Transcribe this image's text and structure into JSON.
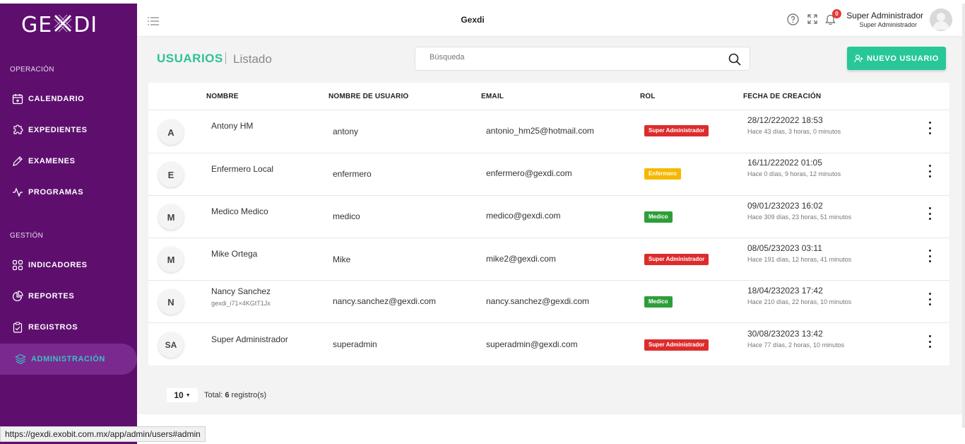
{
  "app": {
    "logo": "GEXDI",
    "title": "Gexdi"
  },
  "sidebar": {
    "sections": [
      {
        "label": "OPERACIÓN"
      },
      {
        "label": "GESTIÓN"
      }
    ],
    "items": [
      {
        "label": "CALENDARIO",
        "icon": "calendar-plus-icon"
      },
      {
        "label": "EXPEDIENTES",
        "icon": "puzzle-icon"
      },
      {
        "label": "EXAMENES",
        "icon": "pen-icon"
      },
      {
        "label": "PROGRAMAS",
        "icon": "activity-icon"
      },
      {
        "label": "INDICADORES",
        "icon": "grid-icon"
      },
      {
        "label": "REPORTES",
        "icon": "pie-chart-icon"
      },
      {
        "label": "REGISTROS",
        "icon": "clipboard-icon"
      },
      {
        "label": "ADMINISTRACIÓN",
        "icon": "layers-icon",
        "active": true
      }
    ]
  },
  "topbar": {
    "notifications_count": "0",
    "user_name": "Super Administrador",
    "user_role": "Super Administrador"
  },
  "page": {
    "title": "USUARIOS",
    "subtitle": "Listado",
    "search_placeholder": "Búsqueda",
    "new_button_label": "NUEVO USUARIO"
  },
  "table": {
    "headers": {
      "name": "NOMBRE",
      "username": "NOMBRE DE USUARIO",
      "email": "EMAIL",
      "role": "ROL",
      "created": "FECHA DE CREACIÓN"
    },
    "rows": [
      {
        "initials": "A",
        "name": "Antony HM",
        "subname": "",
        "username": "antony",
        "email": "antonio_hm25@hotmail.com",
        "role": "Super Administrador",
        "role_color": "#dd2c2c",
        "date": "28/12/222022 18:53",
        "ago": "Hace 43 días, 3 horas, 0 minutos"
      },
      {
        "initials": "E",
        "name": "Enfermero Local",
        "subname": "",
        "username": "enfermero",
        "email": "enfermero@gexdi.com",
        "role": "Enfermero",
        "role_color": "#f5b800",
        "date": "16/11/222022 01:05",
        "ago": "Hace 0 días, 9 horas, 12 minutos"
      },
      {
        "initials": "M",
        "name": "Medico Medico",
        "subname": "",
        "username": "medico",
        "email": "medico@gexdi.com",
        "role": "Medico",
        "role_color": "#2e9e3a",
        "date": "09/01/232023 16:02",
        "ago": "Hace 309 días, 23 horas, 51 minutos"
      },
      {
        "initials": "M",
        "name": "Mike Ortega",
        "subname": "",
        "username": "Mike",
        "email": "mike2@gexdi.com",
        "role": "Super Administrador",
        "role_color": "#dd2c2c",
        "date": "08/05/232023 03:11",
        "ago": "Hace 191 días, 12 horas, 41 minutos"
      },
      {
        "initials": "N",
        "name": "Nancy Sanchez",
        "subname": "gexdi_i71×4KGtT1Jx",
        "username": "nancy.sanchez@gexdi.com",
        "email": "nancy.sanchez@gexdi.com",
        "role": "Medico",
        "role_color": "#2e9e3a",
        "date": "18/04/232023 17:42",
        "ago": "Hace 210 días, 22 horas, 10 minutos"
      },
      {
        "initials": "SA",
        "name": "Super Administrador",
        "subname": "",
        "username": "superadmin",
        "email": "superadmin@gexdi.com",
        "role": "Super Administrador",
        "role_color": "#dd2c2c",
        "date": "30/08/232023 13:42",
        "ago": "Hace 77 días, 2 horas, 10 minutos"
      }
    ]
  },
  "pagination": {
    "page_size": "10",
    "total_prefix": "Total:",
    "total_count": "6",
    "total_suffix": "registro(s)"
  },
  "browser": {
    "status_url": "https://gexdi.exobit.com.mx/app/admin/users#admin"
  },
  "colors": {
    "sidebar_bg": "#5e0f6e",
    "accent_green": "#27c79a",
    "active_text": "#39c0c8"
  }
}
